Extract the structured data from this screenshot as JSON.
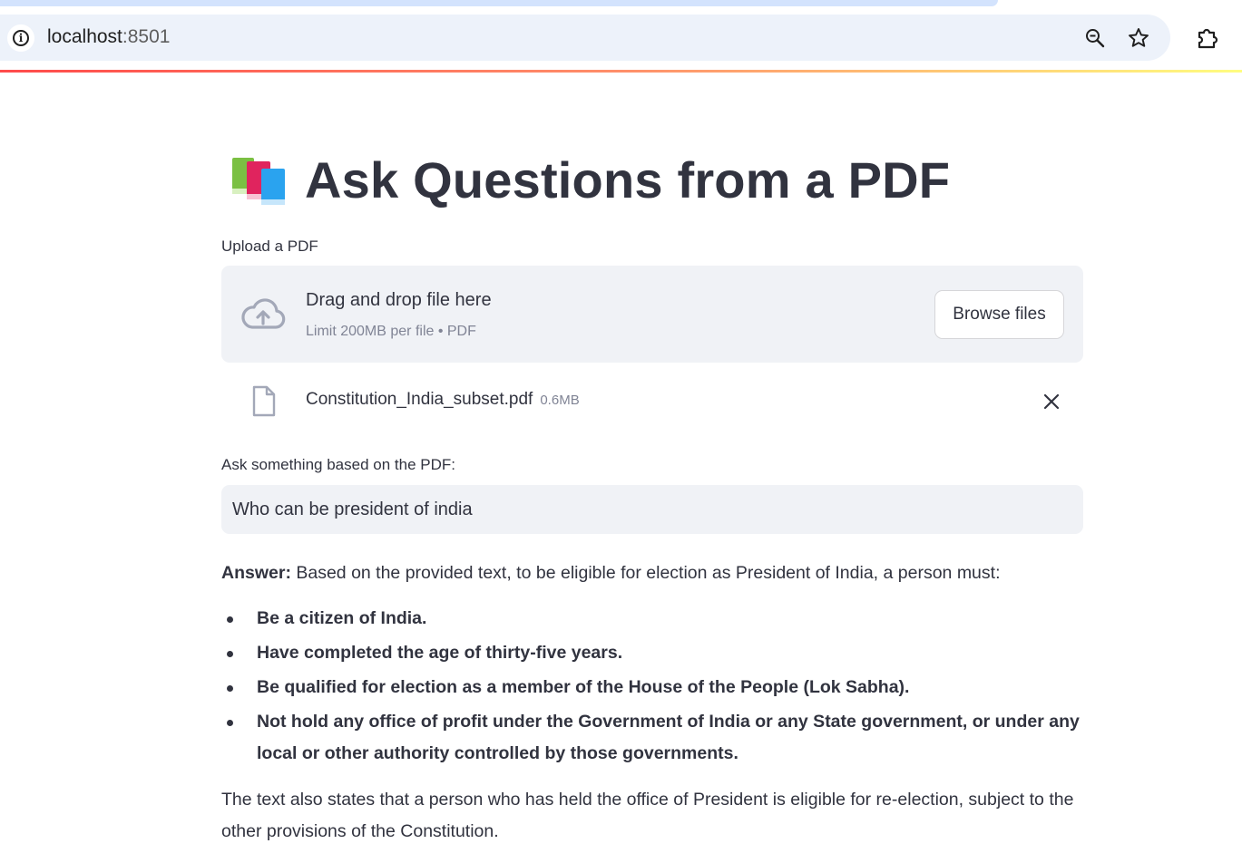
{
  "browser": {
    "url_host": "localhost",
    "url_port": ":8501"
  },
  "page": {
    "title_icon": "books-icon",
    "title": "Ask Questions from a PDF"
  },
  "uploader": {
    "label": "Upload a PDF",
    "drop_text": "Drag and drop file here",
    "limit_text": "Limit 200MB per file • PDF",
    "browse_label": "Browse files",
    "file": {
      "name": "Constitution_India_subset.pdf",
      "size": "0.6MB"
    }
  },
  "question": {
    "label": "Ask something based on the PDF:",
    "value": "Who can be president of india"
  },
  "answer": {
    "prefix": "Answer:",
    "intro": " Based on the provided text, to be eligible for election as President of India, a person must:",
    "items": [
      "Be a citizen of India.",
      "Have completed the age of thirty-five years.",
      "Be qualified for election as a member of the House of the People (Lok Sabha).",
      "Not hold any office of profit under the Government of India or any State government, or under any local or other authority controlled by those governments."
    ],
    "outro": "The text also states that a person who has held the office of President is eligible for re-election, subject to the other provisions of the Constitution."
  },
  "colors": {
    "accent": "#ff4b4b",
    "text": "#31333f",
    "muted": "#808495",
    "surface": "#f0f2f6"
  }
}
